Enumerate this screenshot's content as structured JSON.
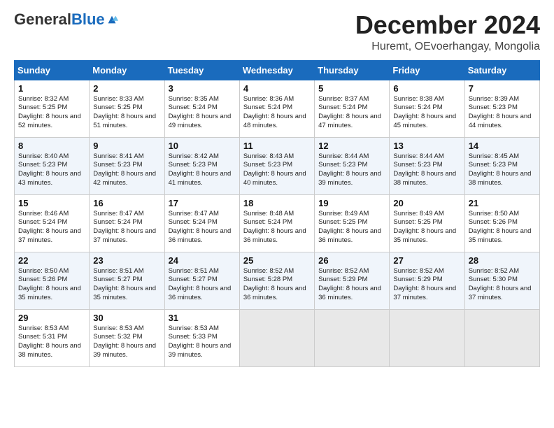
{
  "header": {
    "logo_general": "General",
    "logo_blue": "Blue",
    "main_title": "December 2024",
    "subtitle": "Huremt, OEvoerhangay, Mongolia"
  },
  "days_of_week": [
    "Sunday",
    "Monday",
    "Tuesday",
    "Wednesday",
    "Thursday",
    "Friday",
    "Saturday"
  ],
  "weeks": [
    [
      {
        "day": 1,
        "sunrise": "8:32 AM",
        "sunset": "5:25 PM",
        "daylight": "8 hours and 52 minutes."
      },
      {
        "day": 2,
        "sunrise": "8:33 AM",
        "sunset": "5:25 PM",
        "daylight": "8 hours and 51 minutes."
      },
      {
        "day": 3,
        "sunrise": "8:35 AM",
        "sunset": "5:24 PM",
        "daylight": "8 hours and 49 minutes."
      },
      {
        "day": 4,
        "sunrise": "8:36 AM",
        "sunset": "5:24 PM",
        "daylight": "8 hours and 48 minutes."
      },
      {
        "day": 5,
        "sunrise": "8:37 AM",
        "sunset": "5:24 PM",
        "daylight": "8 hours and 47 minutes."
      },
      {
        "day": 6,
        "sunrise": "8:38 AM",
        "sunset": "5:24 PM",
        "daylight": "8 hours and 45 minutes."
      },
      {
        "day": 7,
        "sunrise": "8:39 AM",
        "sunset": "5:23 PM",
        "daylight": "8 hours and 44 minutes."
      }
    ],
    [
      {
        "day": 8,
        "sunrise": "8:40 AM",
        "sunset": "5:23 PM",
        "daylight": "8 hours and 43 minutes."
      },
      {
        "day": 9,
        "sunrise": "8:41 AM",
        "sunset": "5:23 PM",
        "daylight": "8 hours and 42 minutes."
      },
      {
        "day": 10,
        "sunrise": "8:42 AM",
        "sunset": "5:23 PM",
        "daylight": "8 hours and 41 minutes."
      },
      {
        "day": 11,
        "sunrise": "8:43 AM",
        "sunset": "5:23 PM",
        "daylight": "8 hours and 40 minutes."
      },
      {
        "day": 12,
        "sunrise": "8:44 AM",
        "sunset": "5:23 PM",
        "daylight": "8 hours and 39 minutes."
      },
      {
        "day": 13,
        "sunrise": "8:44 AM",
        "sunset": "5:23 PM",
        "daylight": "8 hours and 38 minutes."
      },
      {
        "day": 14,
        "sunrise": "8:45 AM",
        "sunset": "5:23 PM",
        "daylight": "8 hours and 38 minutes."
      }
    ],
    [
      {
        "day": 15,
        "sunrise": "8:46 AM",
        "sunset": "5:24 PM",
        "daylight": "8 hours and 37 minutes."
      },
      {
        "day": 16,
        "sunrise": "8:47 AM",
        "sunset": "5:24 PM",
        "daylight": "8 hours and 37 minutes."
      },
      {
        "day": 17,
        "sunrise": "8:47 AM",
        "sunset": "5:24 PM",
        "daylight": "8 hours and 36 minutes."
      },
      {
        "day": 18,
        "sunrise": "8:48 AM",
        "sunset": "5:24 PM",
        "daylight": "8 hours and 36 minutes."
      },
      {
        "day": 19,
        "sunrise": "8:49 AM",
        "sunset": "5:25 PM",
        "daylight": "8 hours and 36 minutes."
      },
      {
        "day": 20,
        "sunrise": "8:49 AM",
        "sunset": "5:25 PM",
        "daylight": "8 hours and 35 minutes."
      },
      {
        "day": 21,
        "sunrise": "8:50 AM",
        "sunset": "5:26 PM",
        "daylight": "8 hours and 35 minutes."
      }
    ],
    [
      {
        "day": 22,
        "sunrise": "8:50 AM",
        "sunset": "5:26 PM",
        "daylight": "8 hours and 35 minutes."
      },
      {
        "day": 23,
        "sunrise": "8:51 AM",
        "sunset": "5:27 PM",
        "daylight": "8 hours and 35 minutes."
      },
      {
        "day": 24,
        "sunrise": "8:51 AM",
        "sunset": "5:27 PM",
        "daylight": "8 hours and 36 minutes."
      },
      {
        "day": 25,
        "sunrise": "8:52 AM",
        "sunset": "5:28 PM",
        "daylight": "8 hours and 36 minutes."
      },
      {
        "day": 26,
        "sunrise": "8:52 AM",
        "sunset": "5:29 PM",
        "daylight": "8 hours and 36 minutes."
      },
      {
        "day": 27,
        "sunrise": "8:52 AM",
        "sunset": "5:29 PM",
        "daylight": "8 hours and 37 minutes."
      },
      {
        "day": 28,
        "sunrise": "8:52 AM",
        "sunset": "5:30 PM",
        "daylight": "8 hours and 37 minutes."
      }
    ],
    [
      {
        "day": 29,
        "sunrise": "8:53 AM",
        "sunset": "5:31 PM",
        "daylight": "8 hours and 38 minutes."
      },
      {
        "day": 30,
        "sunrise": "8:53 AM",
        "sunset": "5:32 PM",
        "daylight": "8 hours and 39 minutes."
      },
      {
        "day": 31,
        "sunrise": "8:53 AM",
        "sunset": "5:33 PM",
        "daylight": "8 hours and 39 minutes."
      },
      null,
      null,
      null,
      null
    ]
  ]
}
